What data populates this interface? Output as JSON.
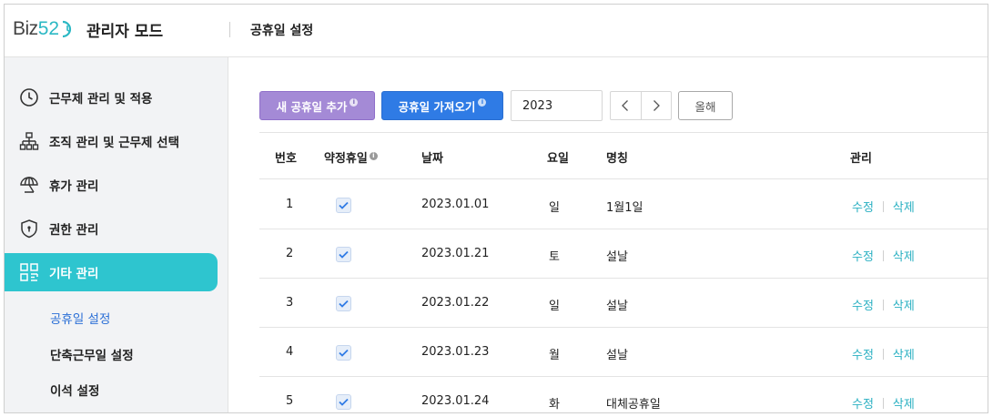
{
  "header": {
    "logo_text": "Biz",
    "logo_num": "52",
    "admin_mode": "관리자 모드",
    "page_title": "공휴일 설정"
  },
  "sidebar": {
    "items": [
      {
        "label": "근무제 관리 및 적용",
        "icon": "clock-icon"
      },
      {
        "label": "조직 관리 및 근무제 선택",
        "icon": "org-chart-icon"
      },
      {
        "label": "휴가 관리",
        "icon": "umbrella-icon"
      },
      {
        "label": "권한 관리",
        "icon": "shield-icon"
      },
      {
        "label": "기타 관리",
        "icon": "grid-icon",
        "active": true
      }
    ],
    "sub_items": [
      {
        "label": "공휴일 설정",
        "active": true
      },
      {
        "label": "단축근무일 설정"
      },
      {
        "label": "이석 설정"
      }
    ]
  },
  "toolbar": {
    "add_label": "새 공휴일 추가",
    "import_label": "공휴일 가져오기",
    "info_glyph": "i",
    "year_value": "2023",
    "this_year_label": "올해"
  },
  "table": {
    "headers": {
      "no": "번호",
      "contract": "약정휴일",
      "date": "날짜",
      "weekday": "요일",
      "name": "명칭",
      "manage": "관리"
    },
    "edit_label": "수정",
    "delete_label": "삭제",
    "rows": [
      {
        "no": "1",
        "checked": true,
        "date": "2023.01.01",
        "weekday": "일",
        "name": "1월1일"
      },
      {
        "no": "2",
        "checked": true,
        "date": "2023.01.21",
        "weekday": "토",
        "name": "설날"
      },
      {
        "no": "3",
        "checked": true,
        "date": "2023.01.22",
        "weekday": "일",
        "name": "설날"
      },
      {
        "no": "4",
        "checked": true,
        "date": "2023.01.23",
        "weekday": "월",
        "name": "설날"
      },
      {
        "no": "5",
        "checked": true,
        "date": "2023.01.24",
        "weekday": "화",
        "name": "대체공휴일"
      }
    ]
  },
  "colors": {
    "accent": "#2ec5cf",
    "add_button": "#a48ad6",
    "import_button": "#2f7be5",
    "link": "#2ab0c2",
    "active_sub": "#2b6fd6"
  }
}
